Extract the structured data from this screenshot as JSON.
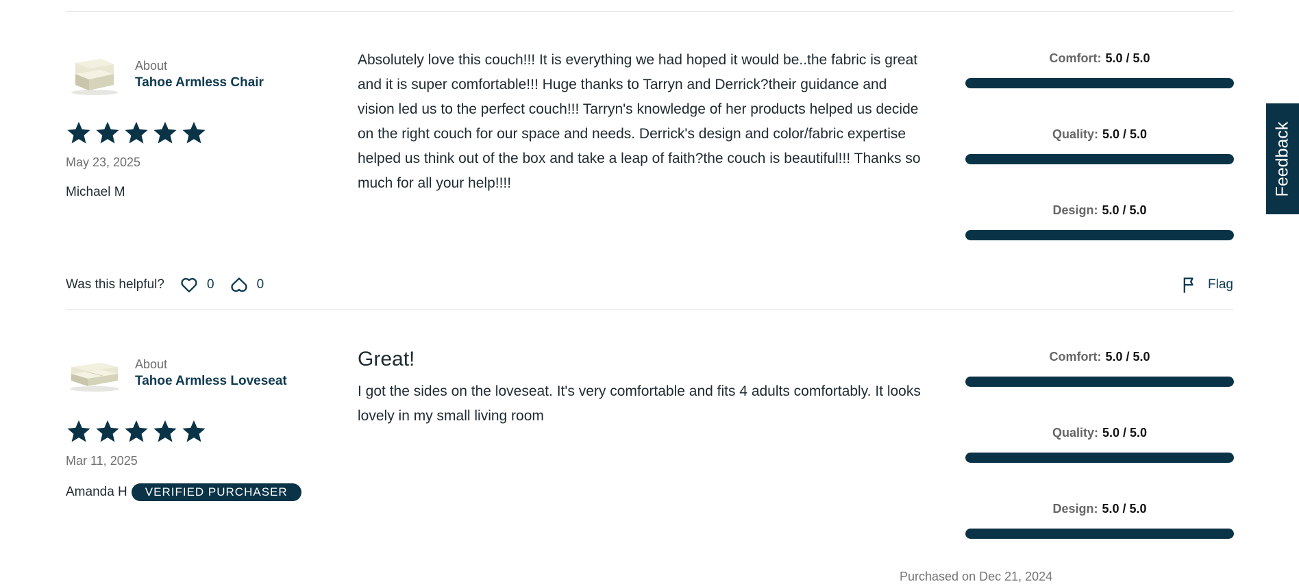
{
  "reviews": [
    {
      "about_label": "About",
      "product_name": "Tahoe Armless Chair",
      "date": "May 23, 2025",
      "author": "Michael M",
      "stars": 5,
      "title": "",
      "body": "Absolutely love this couch!!! It is everything we had hoped it would be..the fabric is great and it is super comfortable!!! Huge thanks to Tarryn and Derrick?their guidance and vision led us to the perfect couch!!! Tarryn's knowledge of her products helped us decide on the right couch for our space and needs. Derrick's design and color/fabric expertise helped us think out of the box and take a leap of faith?the couch is beautiful!!! Thanks so much for all your help!!!!",
      "ratings": [
        {
          "label": "Comfort:",
          "value": "5.0 / 5.0",
          "fraction": 1.0
        },
        {
          "label": "Quality:",
          "value": "5.0 / 5.0",
          "fraction": 1.0
        },
        {
          "label": "Design:",
          "value": "5.0 / 5.0",
          "fraction": 1.0
        }
      ]
    },
    {
      "about_label": "About",
      "product_name": "Tahoe Armless Loveseat",
      "date": "Mar 11, 2025",
      "author": "Amanda H",
      "badge": "VERIFIED PURCHASER",
      "stars": 5,
      "title": "Great!",
      "body": "I got the sides on the loveseat. It's very comfortable and fits 4 adults comfortably. It looks lovely in my small living room",
      "ratings": [
        {
          "label": "Comfort:",
          "value": "5.0 / 5.0",
          "fraction": 1.0
        },
        {
          "label": "Quality:",
          "value": "5.0 / 5.0",
          "fraction": 1.0
        },
        {
          "label": "Design:",
          "value": "5.0 / 5.0",
          "fraction": 1.0
        }
      ],
      "purchased": "Purchased on Dec 21, 2024"
    }
  ],
  "helpful": {
    "question": "Was this helpful?",
    "likes": "0",
    "dislikes": "0",
    "flag_label": "Flag"
  },
  "feedback_tab": "Feedback",
  "colors": {
    "primary": "#0a3347",
    "link": "#0e3a4f",
    "divider": "#dde2e4"
  },
  "icons": {
    "star": "star-icon",
    "like": "heart-icon",
    "dislike": "broken-heart-icon",
    "flag": "flag-icon"
  }
}
